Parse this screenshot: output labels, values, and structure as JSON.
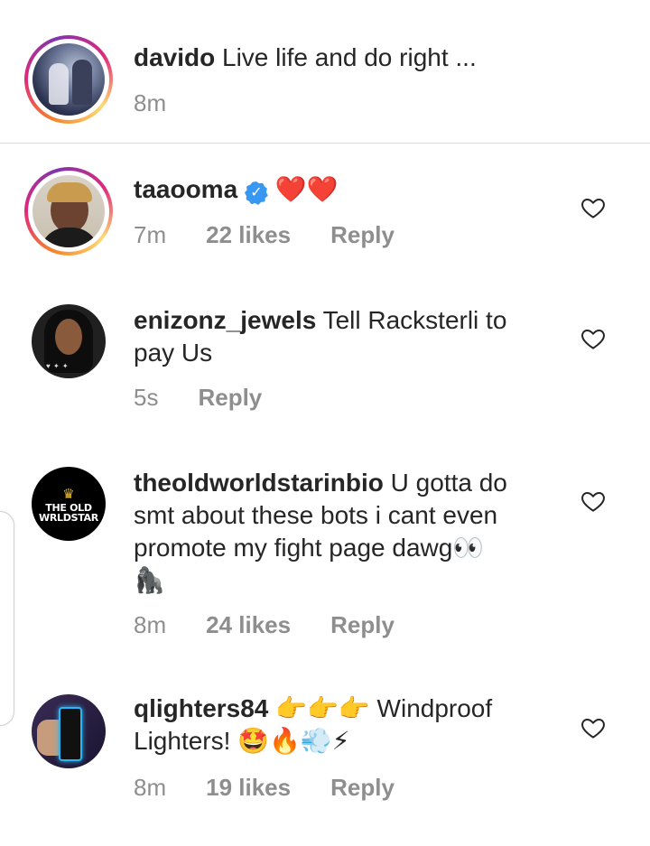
{
  "caption": {
    "username": "davido",
    "text": "Live life and do right ...",
    "time": "8m"
  },
  "comments": [
    {
      "username": "taaooma",
      "verified": true,
      "text": "❤️❤️",
      "time": "7m",
      "likes": "22 likes",
      "reply": "Reply"
    },
    {
      "username": "enizonz_jewels",
      "text_line1": "Tell Racksterli to",
      "text_line2": "pay Us",
      "time": "5s",
      "reply": "Reply"
    },
    {
      "username": "theoldworldstarinbio",
      "text_line1": "U gotta do",
      "text_line2": "smt about these bots i cant even",
      "text_line3": "promote my fight page dawg👀",
      "text_line4": "🦍",
      "avatar_text_1": "THE OLD",
      "avatar_text_2": "WRLDSTAR",
      "time": "8m",
      "likes": "24 likes",
      "reply": "Reply"
    },
    {
      "username": "qlighters84",
      "text_line1_emoji": "👉👉👉",
      "text_line1": "Windproof",
      "text_line2": "Lighters!",
      "text_line2_emoji": "🤩🔥💨⚡",
      "time": "8m",
      "likes": "19 likes",
      "reply": "Reply"
    }
  ],
  "icons": {
    "like": "heart-outline-icon",
    "verified": "verified-badge-icon"
  },
  "colors": {
    "text": "#262626",
    "meta": "#8e8e8e",
    "verified": "#3897f0",
    "heart_red": "#ed4956"
  }
}
